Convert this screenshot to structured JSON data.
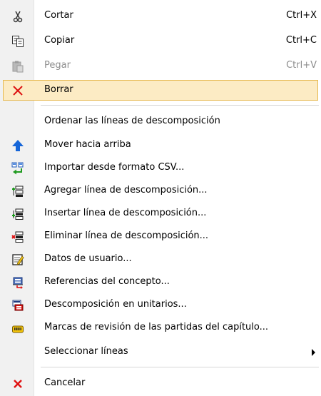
{
  "menu": {
    "cut": {
      "label": "Cortar",
      "shortcut": "Ctrl+X",
      "icon": "scissors-icon"
    },
    "copy": {
      "label": "Copiar",
      "shortcut": "Ctrl+C",
      "icon": "copy-icon"
    },
    "paste": {
      "label": "Pegar",
      "shortcut": "Ctrl+V",
      "icon": "paste-icon",
      "disabled": true
    },
    "delete": {
      "label": "Borrar",
      "icon": "red-x-icon",
      "highlighted": true
    },
    "sort": {
      "label": "Ordenar las líneas de descomposición"
    },
    "move_up": {
      "label": "Mover hacia arriba",
      "icon": "blue-up-arrow-icon"
    },
    "import_csv": {
      "label": "Importar desde formato CSV...",
      "icon": "import-icon"
    },
    "add_line": {
      "label": "Agregar línea de descomposición...",
      "icon": "add-line-icon"
    },
    "insert_line": {
      "label": "Insertar línea de descomposición...",
      "icon": "insert-line-icon"
    },
    "remove_line": {
      "label": "Eliminar línea de descomposición...",
      "icon": "remove-line-icon"
    },
    "user_data": {
      "label": "Datos de usuario...",
      "icon": "user-data-icon"
    },
    "references": {
      "label": "Referencias del concepto...",
      "icon": "references-icon"
    },
    "decomposition": {
      "label": "Descomposición en unitarios...",
      "icon": "decomposition-icon"
    },
    "review_marks": {
      "label": "Marcas de revisión de las partidas del capítulo...",
      "icon": "review-marks-icon"
    },
    "select_lines": {
      "label": "Seleccionar líneas",
      "has_submenu": true
    },
    "cancel": {
      "label": "Cancelar",
      "icon": "red-x-icon"
    }
  },
  "colors": {
    "highlight_bg": "#fcebc4",
    "highlight_border": "#e6b84e",
    "disabled_text": "#8d8d8d"
  }
}
